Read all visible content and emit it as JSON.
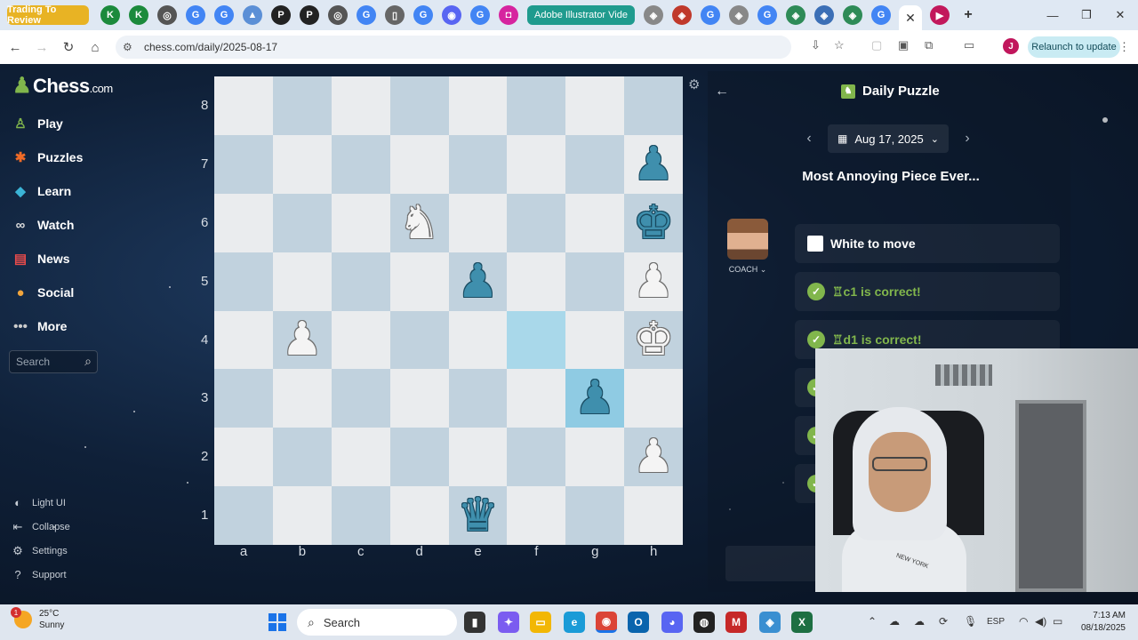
{
  "browser": {
    "tabs": {
      "pinned_label": "Trading To Review",
      "group_label": "Adobe Illustrator Vide",
      "new_tab_glyph": "+",
      "close_glyph": "✕"
    },
    "url": "chess.com/daily/2025-08-17",
    "relaunch_label": "Relaunch to update",
    "profile_initial": "J"
  },
  "sidebar": {
    "brand": "Chess",
    "brand_suffix": ".com",
    "items": [
      {
        "label": "Play",
        "icon": "play-icon"
      },
      {
        "label": "Puzzles",
        "icon": "puzzles-icon"
      },
      {
        "label": "Learn",
        "icon": "learn-icon"
      },
      {
        "label": "Watch",
        "icon": "watch-icon"
      },
      {
        "label": "News",
        "icon": "news-icon"
      },
      {
        "label": "Social",
        "icon": "social-icon"
      },
      {
        "label": "More",
        "icon": "more-icon"
      }
    ],
    "search_placeholder": "Search",
    "footer": [
      {
        "label": "Light UI",
        "icon": "light-ui-icon"
      },
      {
        "label": "Collapse",
        "icon": "collapse-icon"
      },
      {
        "label": "Settings",
        "icon": "settings-icon"
      },
      {
        "label": "Support",
        "icon": "support-icon"
      }
    ]
  },
  "board": {
    "ranks": [
      "8",
      "7",
      "6",
      "5",
      "4",
      "3",
      "2",
      "1"
    ],
    "files": [
      "a",
      "b",
      "c",
      "d",
      "e",
      "f",
      "g",
      "h"
    ],
    "pieces": {
      "h7": "bp",
      "d6": "wn",
      "h6": "bk",
      "e5": "bp",
      "h5": "wp",
      "b4": "wp",
      "h4": "wk",
      "g3": "bp",
      "h2": "wp",
      "e1": "bq"
    },
    "highlight_squares": [
      "f4",
      "g3"
    ]
  },
  "panel": {
    "title": "Daily Puzzle",
    "date": "Aug 17, 2025",
    "puzzle_name": "Most Annoying Piece Ever...",
    "coach_label": "COACH",
    "messages": [
      {
        "text": "White to move",
        "type": "turn"
      },
      {
        "text": "♖c1 is correct!",
        "type": "correct"
      },
      {
        "text": "♖d1 is correct!",
        "type": "correct"
      }
    ]
  },
  "webcam": {
    "shirt_text": "NEW YORK"
  },
  "taskbar": {
    "weather_temp": "25°C",
    "weather_desc": "Sunny",
    "weather_badge": "1",
    "search_label": "Search",
    "language": "ESP",
    "time": "7:13 AM",
    "date": "08/18/2025"
  },
  "colors": {
    "board_light": "#eaecee",
    "board_dark": "#c1d2de",
    "highlight": "#a9d8ea",
    "accent_green": "#81b64c"
  }
}
